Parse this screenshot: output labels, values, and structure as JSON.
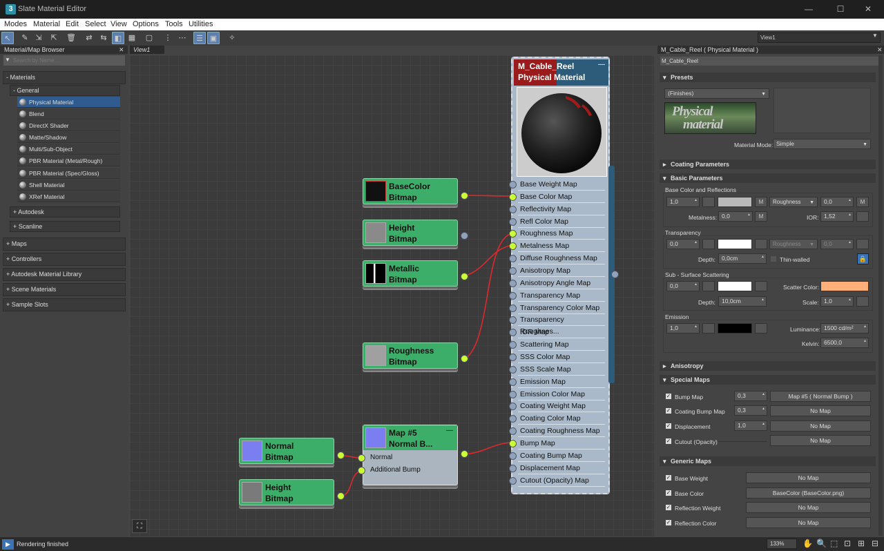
{
  "window": {
    "title": "Slate Material Editor",
    "minimize": "—",
    "maximize": "☐",
    "close": "✕"
  },
  "menu": [
    "Modes",
    "Material",
    "Edit",
    "Select",
    "View",
    "Options",
    "Tools",
    "Utilities"
  ],
  "toolbar": {
    "view_select": "View1"
  },
  "browser": {
    "title": "Material/Map Browser",
    "search_placeholder": "Search by Name ...",
    "materials_label": "- Materials",
    "general_label": "- General",
    "general_items": [
      "Physical Material",
      "Blend",
      "DirectX Shader",
      "Matte/Shadow",
      "Multi/Sub-Object",
      "PBR Material (Metal/Rough)",
      "PBR Material (Spec/Gloss)",
      "Shell Material",
      "XRef Material"
    ],
    "autodesk_label": "+ Autodesk",
    "scanline_label": "+ Scanline",
    "sections": [
      "+ Maps",
      "+ Controllers",
      "+ Autodesk Material Library",
      "+ Scene Materials",
      "+ Sample Slots"
    ]
  },
  "view": {
    "tab": "View1",
    "nodes": {
      "basecolor": [
        "BaseColor",
        "Bitmap"
      ],
      "height1": [
        "Height",
        "Bitmap"
      ],
      "metallic": [
        "Metallic",
        "Bitmap"
      ],
      "roughness": [
        "Roughness",
        "Bitmap"
      ],
      "normal": [
        "Normal",
        "Bitmap"
      ],
      "height2": [
        "Height",
        "Bitmap"
      ],
      "map5": [
        "Map #5",
        "Normal B..."
      ],
      "map5_inputs": [
        "Normal",
        "Additional Bump"
      ]
    },
    "material_node": {
      "title1": "M_Cable_Reel",
      "title2": "Physical Material",
      "slots": [
        "Base Weight Map",
        "Base Color Map",
        "Reflectivity Map",
        "Refl Color Map",
        "Roughness Map",
        "Metalness Map",
        "Diffuse Roughness Map",
        "Anisotropy Map",
        "Anisotropy Angle Map",
        "Transparency Map",
        "Transparency Color Map",
        "Transparency  Roughnes...",
        "IOR Map",
        "Scattering Map",
        "SSS Color Map",
        "SSS Scale Map",
        "Emission Map",
        "Emission Color Map",
        "Coating Weight Map",
        "Coating Color Map",
        "Coating Roughness Map",
        "Bump Map",
        "Coating Bump Map",
        "Displacement Map",
        "Cutout (Opacity) Map"
      ]
    }
  },
  "props": {
    "title": "M_Cable_Reel  ( Physical Material )",
    "name": "M_Cable_Reel",
    "presets": {
      "header": "Presets",
      "finishes": "(Finishes)",
      "logo1": "Physical",
      "logo2": "material",
      "mode_label": "Material Mode:",
      "mode_value": "Simple"
    },
    "coating_header": "Coating Parameters",
    "basic": {
      "header": "Basic Parameters",
      "bcr_label": "Base Color and Reflections",
      "base_weight": "1,0",
      "m": "M",
      "roughness_drop": "Roughness",
      "roughness_value": "0,0",
      "metalness_label": "Metalness:",
      "metalness_value": "0,0",
      "ior_label": "IOR:",
      "ior_value": "1,52",
      "transparency_label": "Transparency",
      "transparency_value": "0,0",
      "t_roughness_drop": "Roughness",
      "t_roughness_value": "0,0",
      "depth_label": "Depth:",
      "depth_value": "0,0cm",
      "thin_walled": "Thin-walled",
      "sss_label": "Sub - Surface Scattering",
      "sss_value": "0,0",
      "scatter_color_label": "Scatter Color:",
      "sss_depth_label": "Depth:",
      "sss_depth_value": "10,0cm",
      "scale_label": "Scale:",
      "scale_value": "1,0",
      "emission_label": "Emission",
      "emission_value": "1,0",
      "luminance_label": "Luminance:",
      "luminance_value": "1500 cd/m²",
      "kelvin_label": "Kelvin:",
      "kelvin_value": "6500,0"
    },
    "anisotropy_header": "Anisotropy",
    "special": {
      "header": "Special Maps",
      "rows": [
        {
          "label": "Bump Map",
          "value": "0,3",
          "map": "Map #5  ( Normal Bump )"
        },
        {
          "label": "Coating Bump Map",
          "value": "0,3",
          "map": "No Map"
        },
        {
          "label": "Displacement",
          "value": "1,0",
          "map": "No Map"
        },
        {
          "label": "Cutout (Opacity)",
          "value": "",
          "map": "No Map"
        }
      ]
    },
    "generic": {
      "header": "Generic Maps",
      "rows": [
        {
          "label": "Base Weight",
          "map": "No Map"
        },
        {
          "label": "Base Color",
          "map": "BaseColor (BaseColor.png)"
        },
        {
          "label": "Reflection Weight",
          "map": "No Map"
        },
        {
          "label": "Reflection Color",
          "map": "No Map"
        }
      ]
    }
  },
  "status": {
    "text": "Rendering finished",
    "zoom": "133%"
  },
  "colors": {
    "node_green": "#3dad6a",
    "socket_active": "#ccff33",
    "wire": "#e0282d",
    "scatter": "#ffb07a"
  }
}
